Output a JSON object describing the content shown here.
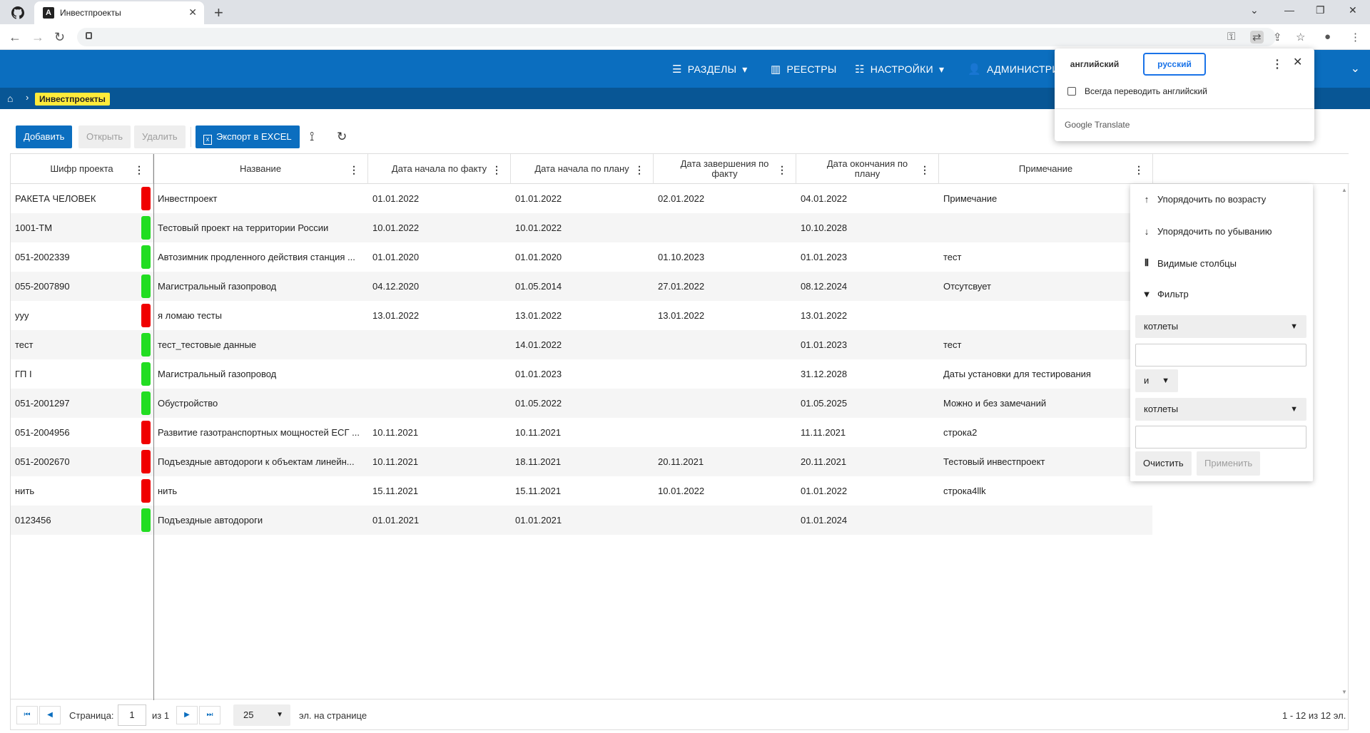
{
  "browser": {
    "tab_title": "Инвестпроекты",
    "tab_icon": "angular-icon",
    "new_tab": "+"
  },
  "header": {
    "nav": [
      {
        "label": "РАЗДЕЛЫ",
        "icon": "menu-icon",
        "dropdown": true
      },
      {
        "label": "РЕЕСТРЫ",
        "icon": "registry-icon",
        "dropdown": false
      },
      {
        "label": "НАСТРОЙКИ",
        "icon": "sliders-icon",
        "dropdown": true
      },
      {
        "label": "АДМИНИСТРИ",
        "icon": "user-icon",
        "dropdown": false
      }
    ],
    "color": "#0b6ebf"
  },
  "breadcrumb": {
    "current": "Инвестпроекты",
    "highlight_color": "#ffeb3b"
  },
  "toolbar": {
    "add": "Добавить",
    "open": "Открыть",
    "delete": "Удалить",
    "export": "Экспорт в EXCEL"
  },
  "grid": {
    "columns": [
      "Шифр проекта",
      "Название",
      "Дата начала по факту",
      "Дата начала по плану",
      "Дата завершения по факту",
      "Дата окончания по плану",
      "Примечание"
    ],
    "rows": [
      {
        "code": "РАКЕТА ЧЕЛОВЕК",
        "status": "red",
        "name": "Инвестпроект",
        "start_fact": "01.01.2022",
        "start_plan": "01.01.2022",
        "end_fact": "02.01.2022",
        "end_plan": "04.01.2022",
        "note": "Примечание"
      },
      {
        "code": "1001-ТМ",
        "status": "green",
        "name": "Тестовый проект на территории России",
        "start_fact": "10.01.2022",
        "start_plan": "10.01.2022",
        "end_fact": "",
        "end_plan": "10.10.2028",
        "note": ""
      },
      {
        "code": "051-2002339",
        "status": "green",
        "name": "Автозимник продленного действия станция ...",
        "start_fact": "01.01.2020",
        "start_plan": "01.01.2020",
        "end_fact": "01.10.2023",
        "end_plan": "01.01.2023",
        "note": "тест"
      },
      {
        "code": "055-2007890",
        "status": "green",
        "name": "Магистральный газопровод",
        "start_fact": "04.12.2020",
        "start_plan": "01.05.2014",
        "end_fact": "27.01.2022",
        "end_plan": "08.12.2024",
        "note": "Отсутсвует"
      },
      {
        "code": "ууу",
        "status": "red",
        "name": "я ломаю тесты",
        "start_fact": "13.01.2022",
        "start_plan": "13.01.2022",
        "end_fact": "13.01.2022",
        "end_plan": "13.01.2022",
        "note": ""
      },
      {
        "code": "тест",
        "status": "green",
        "name": "тест_тестовые данные",
        "start_fact": "",
        "start_plan": "14.01.2022",
        "end_fact": "",
        "end_plan": "01.01.2023",
        "note": "тест"
      },
      {
        "code": "ГП I",
        "status": "green",
        "name": "Магистральный газопровод",
        "start_fact": "",
        "start_plan": "01.01.2023",
        "end_fact": "",
        "end_plan": "31.12.2028",
        "note": "Даты установки для тестирования"
      },
      {
        "code": "051-2001297",
        "status": "green",
        "name": "Обустройство",
        "start_fact": "",
        "start_plan": "01.05.2022",
        "end_fact": "",
        "end_plan": "01.05.2025",
        "note": "Можно и без замечаний"
      },
      {
        "code": "051-2004956",
        "status": "red",
        "name": "Развитие газотранспортных мощностей ЕСГ ...",
        "start_fact": "10.11.2021",
        "start_plan": "10.11.2021",
        "end_fact": "",
        "end_plan": "11.11.2021",
        "note": "строка2"
      },
      {
        "code": "051-2002670",
        "status": "red",
        "name": "Подъездные автодороги к объектам линейн...",
        "start_fact": "10.11.2021",
        "start_plan": "18.11.2021",
        "end_fact": "20.11.2021",
        "end_plan": "20.11.2021",
        "note": "Тестовый инвестпроект"
      },
      {
        "code": "нить",
        "status": "red",
        "name": "нить",
        "start_fact": "15.11.2021",
        "start_plan": "15.11.2021",
        "end_fact": "10.01.2022",
        "end_plan": "01.01.2022",
        "note": "строка4llk"
      },
      {
        "code": "0123456",
        "status": "green",
        "name": "Подъездные автодороги",
        "start_fact": "01.01.2021",
        "start_plan": "01.01.2021",
        "end_fact": "",
        "end_plan": "01.01.2024",
        "note": ""
      }
    ],
    "status_colors": {
      "red": "#f00000",
      "green": "#22dd22"
    }
  },
  "column_menu": {
    "sort_asc": "Упорядочить по возрасту",
    "sort_desc": "Упорядочить по убыванию",
    "visible_columns": "Видимые столбцы",
    "filter": "Фильтр",
    "condition1": "котлеты",
    "operator": "и",
    "condition2": "котлеты",
    "clear": "Очистить",
    "apply": "Применить"
  },
  "pager": {
    "page_label": "Страница:",
    "page": "1",
    "of": "из 1",
    "page_size": "25",
    "per_page": "эл. на странице",
    "summary": "1 - 12 из 12 эл."
  },
  "translate": {
    "lang_source": "английский",
    "lang_target": "русский",
    "always": "Всегда переводить английский",
    "brand": "Google Translate"
  }
}
